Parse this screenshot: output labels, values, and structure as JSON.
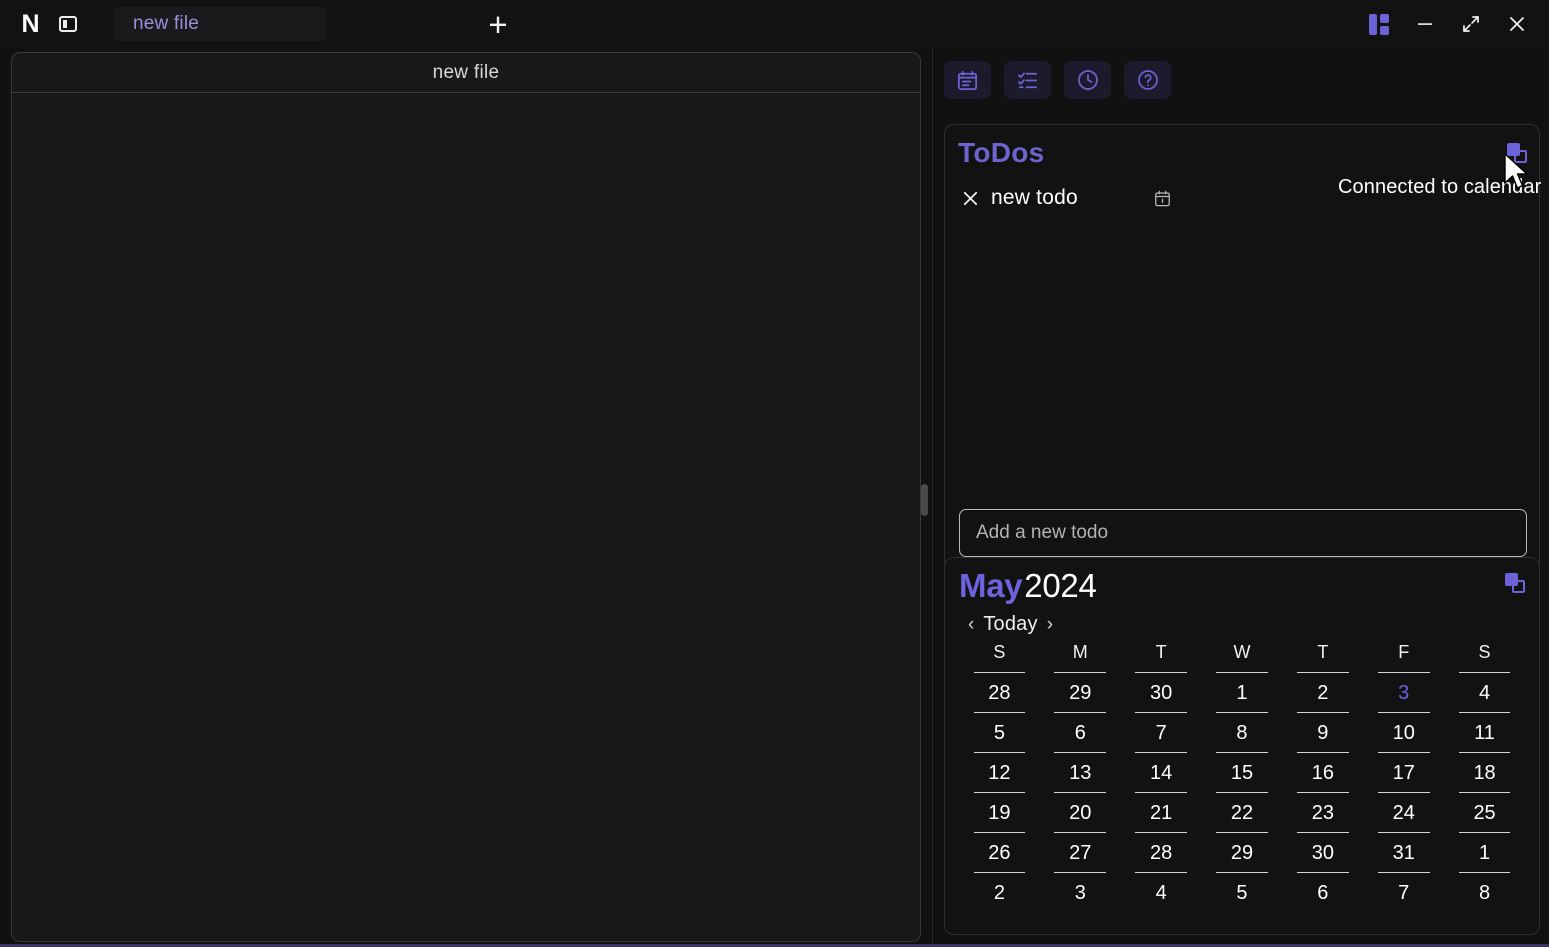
{
  "titlebar": {
    "logo": "N",
    "logo_icon": "app-logo-n",
    "sidebar_toggle_icon": "sidebar-toggle-icon",
    "tabs": [
      {
        "label": "new file",
        "active": true
      }
    ],
    "new_tab_label": "+",
    "window_controls": {
      "layout_label": "layout-grid-icon",
      "minimize_label": "—",
      "maximize_label": "maximize-icon",
      "close_label": "✕"
    }
  },
  "editor": {
    "title": "new file",
    "body_text": ""
  },
  "right_panel": {
    "toolbar": [
      {
        "name": "calendar",
        "icon": "calendar-icon"
      },
      {
        "name": "tasks",
        "icon": "checklist-icon"
      },
      {
        "name": "clock",
        "icon": "clock-icon"
      },
      {
        "name": "help",
        "icon": "question-circle-icon"
      }
    ],
    "todos": {
      "title": "ToDos",
      "duplicate_icon": "duplicate-icon",
      "tooltip": "Connected to calendar",
      "items": [
        {
          "text": "new todo",
          "delete_icon": "close-icon",
          "date_icon": "calendar-icon"
        }
      ],
      "input_placeholder": "Add a new todo",
      "input_value": ""
    },
    "calendar": {
      "month": "May",
      "year": "2024",
      "duplicate_icon": "duplicate-icon",
      "prev_label": "‹",
      "today_label": "Today",
      "next_label": "›",
      "day_headers": [
        "S",
        "M",
        "T",
        "W",
        "T",
        "F",
        "S"
      ],
      "weeks": [
        [
          {
            "d": "28",
            "today": false,
            "underline": true
          },
          {
            "d": "29",
            "today": false,
            "underline": true
          },
          {
            "d": "30",
            "today": false,
            "underline": true
          },
          {
            "d": "1",
            "today": false,
            "underline": true
          },
          {
            "d": "2",
            "today": false,
            "underline": true
          },
          {
            "d": "3",
            "today": true,
            "underline": true
          },
          {
            "d": "4",
            "today": false,
            "underline": true
          }
        ],
        [
          {
            "d": "5",
            "today": false,
            "underline": true
          },
          {
            "d": "6",
            "today": false,
            "underline": true
          },
          {
            "d": "7",
            "today": false,
            "underline": true
          },
          {
            "d": "8",
            "today": false,
            "underline": true
          },
          {
            "d": "9",
            "today": false,
            "underline": true
          },
          {
            "d": "10",
            "today": false,
            "underline": true
          },
          {
            "d": "11",
            "today": false,
            "underline": true
          }
        ],
        [
          {
            "d": "12",
            "today": false,
            "underline": true
          },
          {
            "d": "13",
            "today": false,
            "underline": true
          },
          {
            "d": "14",
            "today": false,
            "underline": true
          },
          {
            "d": "15",
            "today": false,
            "underline": true
          },
          {
            "d": "16",
            "today": false,
            "underline": true
          },
          {
            "d": "17",
            "today": false,
            "underline": true
          },
          {
            "d": "18",
            "today": false,
            "underline": true
          }
        ],
        [
          {
            "d": "19",
            "today": false,
            "underline": true
          },
          {
            "d": "20",
            "today": false,
            "underline": true
          },
          {
            "d": "21",
            "today": false,
            "underline": true
          },
          {
            "d": "22",
            "today": false,
            "underline": true
          },
          {
            "d": "23",
            "today": false,
            "underline": true
          },
          {
            "d": "24",
            "today": false,
            "underline": true
          },
          {
            "d": "25",
            "today": false,
            "underline": true
          }
        ],
        [
          {
            "d": "26",
            "today": false,
            "underline": true
          },
          {
            "d": "27",
            "today": false,
            "underline": true
          },
          {
            "d": "28",
            "today": false,
            "underline": true
          },
          {
            "d": "29",
            "today": false,
            "underline": true
          },
          {
            "d": "30",
            "today": false,
            "underline": true
          },
          {
            "d": "31",
            "today": false,
            "underline": true
          },
          {
            "d": "1",
            "today": false,
            "underline": true
          }
        ],
        [
          {
            "d": "2",
            "today": false,
            "underline": false
          },
          {
            "d": "3",
            "today": false,
            "underline": false
          },
          {
            "d": "4",
            "today": false,
            "underline": false
          },
          {
            "d": "5",
            "today": false,
            "underline": false
          },
          {
            "d": "6",
            "today": false,
            "underline": false
          },
          {
            "d": "7",
            "today": false,
            "underline": false
          },
          {
            "d": "8",
            "today": false,
            "underline": false
          }
        ]
      ]
    }
  },
  "colors": {
    "accent_purple": "#6c63d8",
    "accent_purple_bright": "#6c63dd",
    "todos_title": "#6d64cf",
    "tab_text": "#9a8fe0",
    "window_bg": "#111111",
    "panel_bg": "#121212",
    "editor_bg": "#181818"
  }
}
